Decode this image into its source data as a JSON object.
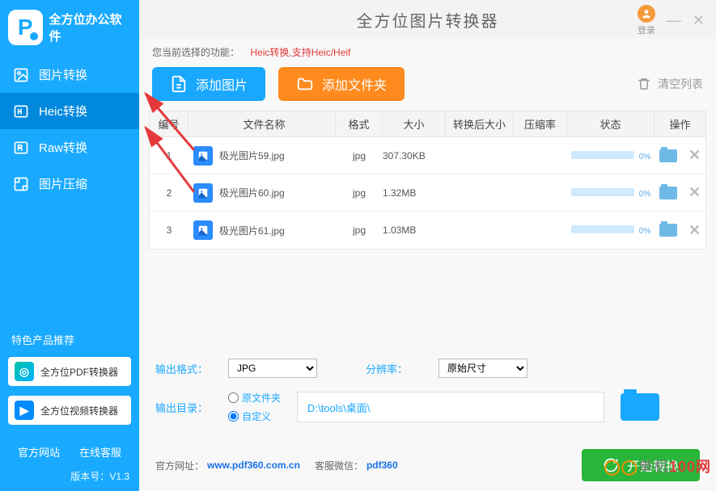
{
  "logo_text": "全方位办公软件",
  "app_title": "全方位图片转换器",
  "login_label": "登录",
  "nav": [
    {
      "label": "图片转换"
    },
    {
      "label": "Heic转换"
    },
    {
      "label": "Raw转换"
    },
    {
      "label": "图片压缩"
    }
  ],
  "promo_header": "特色产品推荐",
  "promo": [
    {
      "label": "全方位PDF转换器"
    },
    {
      "label": "全方位视频转换器"
    }
  ],
  "footer_links": {
    "site": "官方网站",
    "support": "在线客服"
  },
  "version_label": "版本号：",
  "version": "V1.3",
  "current_func_label": "您当前选择的功能：",
  "current_func_value": "Heic转换,支持Heic/Heif",
  "actions": {
    "add_image": "添加图片",
    "add_folder": "添加文件夹",
    "clear": "清空列表"
  },
  "columns": {
    "num": "编号",
    "name": "文件名称",
    "fmt": "格式",
    "size": "大小",
    "after": "转换后大小",
    "ratio": "压缩率",
    "status": "状态",
    "ops": "操作"
  },
  "rows": [
    {
      "num": "1",
      "name": "极光图片59.jpg",
      "fmt": "jpg",
      "size": "307.30KB",
      "progress": "0%"
    },
    {
      "num": "2",
      "name": "极光图片60.jpg",
      "fmt": "jpg",
      "size": "1.32MB",
      "progress": "0%"
    },
    {
      "num": "3",
      "name": "极光图片61.jpg",
      "fmt": "jpg",
      "size": "1.03MB",
      "progress": "0%"
    }
  ],
  "output": {
    "format_label": "输出格式：",
    "format_value": "JPG",
    "res_label": "分辨率：",
    "res_value": "原始尺寸",
    "dir_label": "输出目录：",
    "radio_original": "原文件夹",
    "radio_custom": "自定义",
    "path": "D:\\tools\\桌面\\"
  },
  "bottom": {
    "site_label": "官方网址：",
    "site_link": "www.pdf360.com.cn",
    "wechat_label": "客服微信：",
    "wechat_value": "pdf360",
    "start": "开始转换"
  },
  "watermark": "单机100网"
}
